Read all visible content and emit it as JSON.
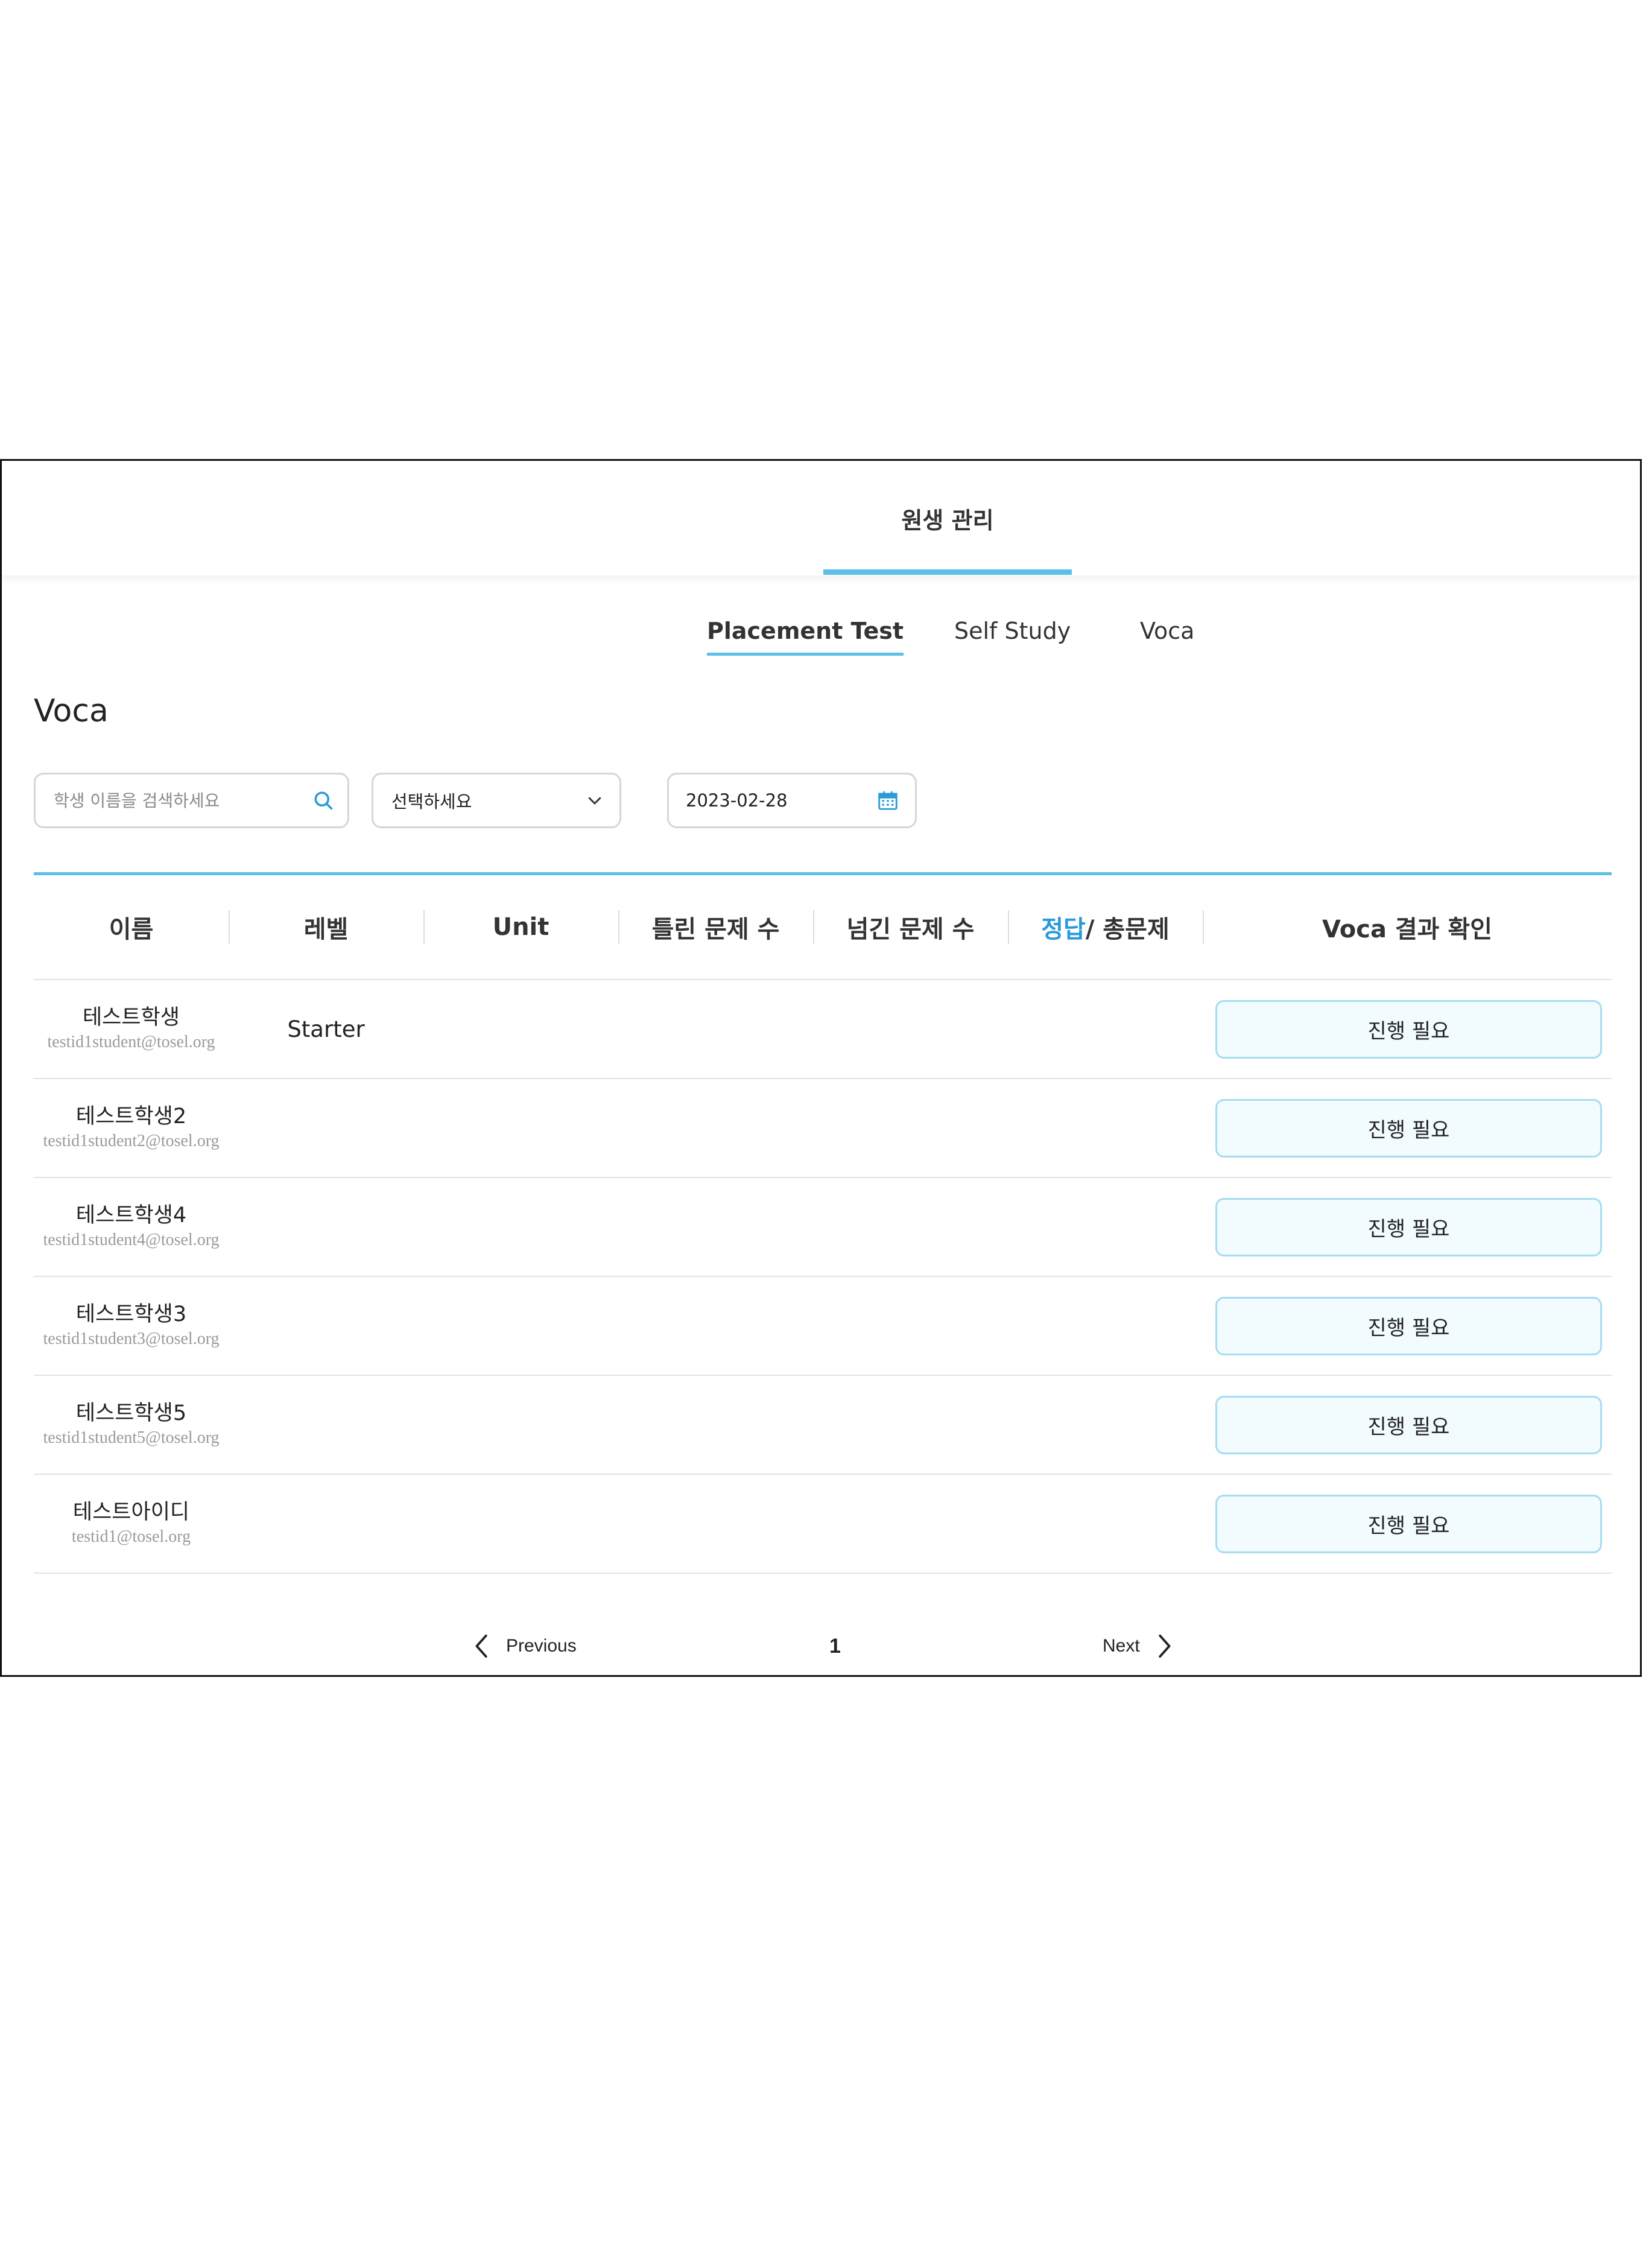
{
  "nav": {
    "main_tab": "원생 관리"
  },
  "sub_tabs": [
    {
      "label": "Placement Test",
      "active": true
    },
    {
      "label": "Self Study",
      "active": false
    },
    {
      "label": "Voca",
      "active": false
    }
  ],
  "page_title": "Voca",
  "filters": {
    "search_placeholder": "학생 이름을 검색하세요",
    "search_value": "",
    "select_value": "선택하세요",
    "date_value": "2023-02-28"
  },
  "table": {
    "headers": {
      "name": "이름",
      "level": "레벨",
      "unit": "Unit",
      "wrong": "틀린 문제 수",
      "skipped": "넘긴 문제 수",
      "correct_prefix": "정답",
      "correct_suffix": "/ 총문제",
      "result": "Voca 결과 확인"
    },
    "rows": [
      {
        "name": "테스트학생",
        "email": "testid1student@tosel.org",
        "level": "Starter",
        "status": "진행 필요"
      },
      {
        "name": "테스트학생2",
        "email": "testid1student2@tosel.org",
        "level": "",
        "status": "진행 필요"
      },
      {
        "name": "테스트학생4",
        "email": "testid1student4@tosel.org",
        "level": "",
        "status": "진행 필요"
      },
      {
        "name": "테스트학생3",
        "email": "testid1student3@tosel.org",
        "level": "",
        "status": "진행 필요"
      },
      {
        "name": "테스트학생5",
        "email": "testid1student5@tosel.org",
        "level": "",
        "status": "진행 필요"
      },
      {
        "name": "테스트아이디",
        "email": "testid1@tosel.org",
        "level": "",
        "status": "진행 필요"
      }
    ]
  },
  "pagination": {
    "previous": "Previous",
    "current": "1",
    "next": "Next"
  },
  "icons": {
    "search": "search-icon",
    "dropdown": "chevron-down-icon",
    "calendar": "calendar-icon",
    "prev": "chevron-left-icon",
    "next": "chevron-right-icon"
  },
  "colors": {
    "accent": "#5bc0e8",
    "accent_text": "#2b9bd8",
    "button_bg": "#f2fbfe",
    "button_border": "#a6dcf2"
  }
}
